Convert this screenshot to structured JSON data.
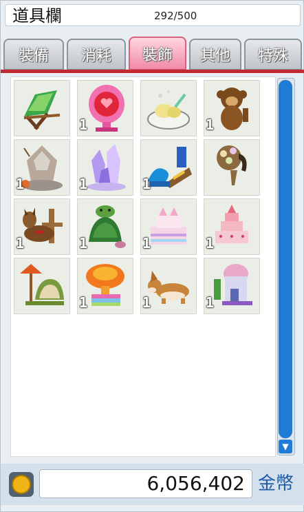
{
  "title": "道具欄",
  "slots_used": "292/500",
  "colors": {
    "active_tab": "#f08aa5",
    "accent_bar": "#c12a32",
    "scrollbar": "#1f7bd4",
    "currency": "#1e5aa5"
  },
  "tabs": [
    {
      "label": "裝備",
      "active": false
    },
    {
      "label": "消耗",
      "active": false
    },
    {
      "label": "裝飾",
      "active": true
    },
    {
      "label": "其他",
      "active": false
    },
    {
      "label": "特殊",
      "active": false
    }
  ],
  "items": [
    {
      "icon": "beach-chair-icon",
      "qty": ""
    },
    {
      "icon": "heart-mirror-icon",
      "qty": "1"
    },
    {
      "icon": "ice-cream-bowl-icon",
      "qty": ""
    },
    {
      "icon": "monkey-plush-icon",
      "qty": "1"
    },
    {
      "icon": "stone-idol-icon",
      "qty": "1"
    },
    {
      "icon": "crystal-cluster-icon",
      "qty": "1"
    },
    {
      "icon": "wave-mountain-icon",
      "qty": "1"
    },
    {
      "icon": "horse-hat-icon",
      "qty": ""
    },
    {
      "icon": "reindeer-icon",
      "qty": "1"
    },
    {
      "icon": "turtle-icon",
      "qty": "1"
    },
    {
      "icon": "cake-castle-icon",
      "qty": "1"
    },
    {
      "icon": "layer-cake-icon",
      "qty": "1"
    },
    {
      "icon": "lamp-house-icon",
      "qty": ""
    },
    {
      "icon": "mushroom-cloud-icon",
      "qty": "1"
    },
    {
      "icon": "corgi-icon",
      "qty": "1"
    },
    {
      "icon": "small-house-icon",
      "qty": "1"
    }
  ],
  "money": "6,056,402",
  "currency_label": "金幣"
}
